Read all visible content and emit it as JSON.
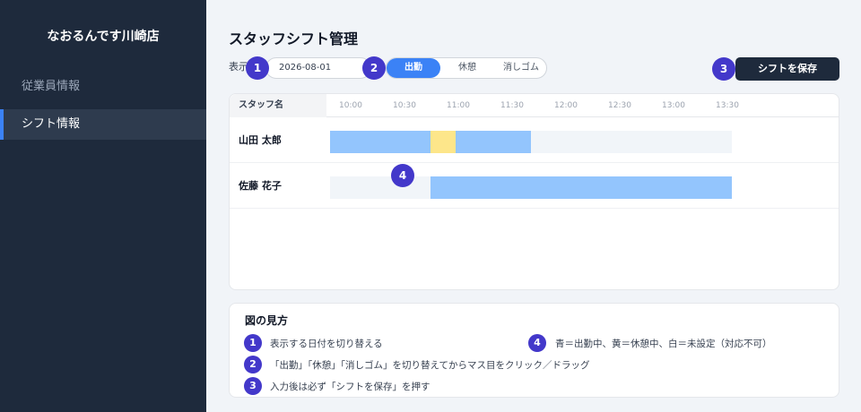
{
  "sidebar": {
    "brand": "なおるんです川崎店",
    "items": [
      {
        "label": "従業員情報"
      },
      {
        "label": "シフト情報"
      }
    ]
  },
  "main": {
    "title": "スタッフシフト管理",
    "display_label": "表示",
    "date_value": "2026-08-01",
    "modes": [
      "出勤",
      "休憩",
      "消しゴム"
    ],
    "selected_mode": "出勤",
    "save_label": "シフトを保存"
  },
  "badges": [
    "1",
    "2",
    "3",
    "4"
  ],
  "grid": {
    "staff_header": "スタッフ名",
    "times": [
      "10:00",
      "10:30",
      "11:00",
      "11:30",
      "12:00",
      "12:30",
      "13:00",
      "13:30"
    ],
    "rows": [
      {
        "name": "山田 太郎",
        "slots": [
          "work",
          "work",
          "work",
          "work",
          "break",
          "work",
          "work",
          "work",
          "none",
          "none",
          "none",
          "none",
          "none",
          "none",
          "none",
          "none"
        ]
      },
      {
        "name": "佐藤 花子",
        "slots": [
          "none",
          "none",
          "none",
          "none",
          "work",
          "work",
          "work",
          "work",
          "work",
          "work",
          "work",
          "work",
          "work",
          "work",
          "work",
          "work"
        ]
      }
    ],
    "colors": {
      "work": "#93c5fd",
      "break": "#fde68a",
      "none": "#f1f5f9"
    }
  },
  "legend": {
    "title": "図の見方",
    "items": [
      {
        "num": "1",
        "text": "表示する日付を切り替える"
      },
      {
        "num": "2",
        "text": "「出勤」「休憩」「消しゴム」を切り替えてからマス目をクリック／ドラッグ"
      },
      {
        "num": "3",
        "text": "入力後は必ず「シフトを保存」を押す"
      },
      {
        "num": "4",
        "text": "青＝出勤中、黄＝休憩中、白＝未設定（対応不可）"
      }
    ]
  }
}
